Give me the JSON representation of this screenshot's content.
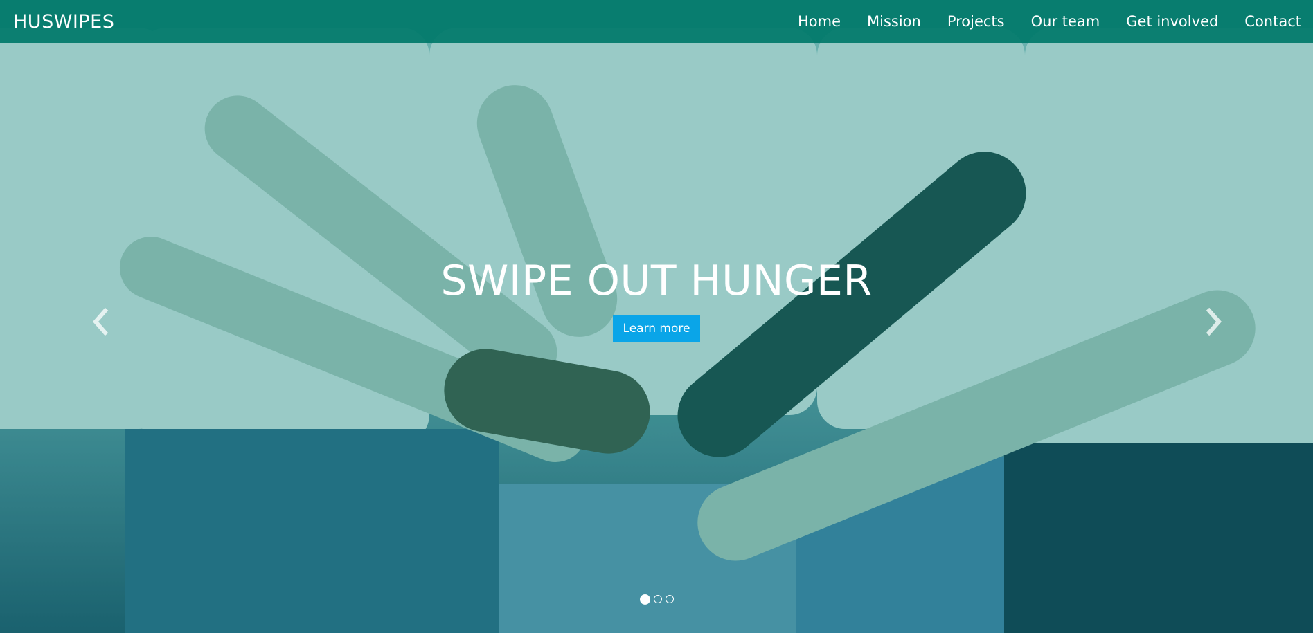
{
  "navbar": {
    "brand": "HUSWIPES",
    "links": [
      {
        "label": "Home"
      },
      {
        "label": "Mission"
      },
      {
        "label": "Projects"
      },
      {
        "label": "Our team"
      },
      {
        "label": "Get involved"
      },
      {
        "label": "Contact"
      }
    ],
    "background_color": "#00786a"
  },
  "hero": {
    "headline": "SWIPE OUT HUNGER",
    "cta_label": "Learn more",
    "cta_color": "#0aa5e8",
    "image_description_icon": "volunteers-hands-photo"
  },
  "carousel": {
    "slide_count": 3,
    "active_slide": 1,
    "prev_icon": "chevron-left-icon",
    "next_icon": "chevron-right-icon"
  }
}
